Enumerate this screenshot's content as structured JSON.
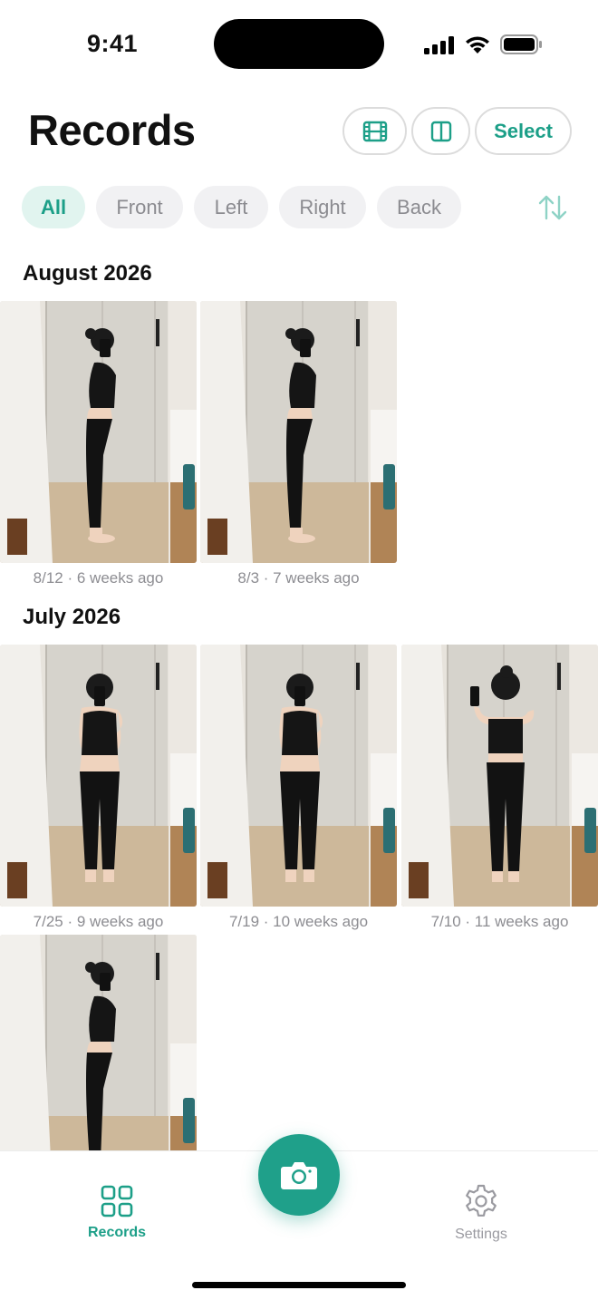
{
  "status_bar": {
    "time": "9:41"
  },
  "header": {
    "title": "Records",
    "film_icon": "film-icon",
    "compare_icon": "split-view-icon",
    "select_label": "Select"
  },
  "filters": {
    "items": [
      "All",
      "Front",
      "Left",
      "Right",
      "Back"
    ],
    "active": "All",
    "sort_icon": "sort-arrows-icon"
  },
  "sections": [
    {
      "title": "August 2026",
      "photos": [
        {
          "pose": "left-side",
          "caption": "8/12 · 6 weeks ago"
        },
        {
          "pose": "left-side",
          "caption": "8/3 · 7 weeks ago"
        }
      ]
    },
    {
      "title": "July 2026",
      "photos": [
        {
          "pose": "front",
          "caption": "7/25 · 9 weeks ago"
        },
        {
          "pose": "front",
          "caption": "7/19 · 10 weeks ago"
        },
        {
          "pose": "back",
          "caption": "7/10 · 11 weeks ago"
        },
        {
          "pose": "left-side",
          "caption": ""
        }
      ]
    }
  ],
  "tab_bar": {
    "records_label": "Records",
    "settings_label": "Settings",
    "camera_icon": "camera-icon"
  },
  "colors": {
    "accent": "#1c9f88",
    "accent_bg": "#e1f4ef",
    "chip_bg": "#f1f1f3"
  }
}
